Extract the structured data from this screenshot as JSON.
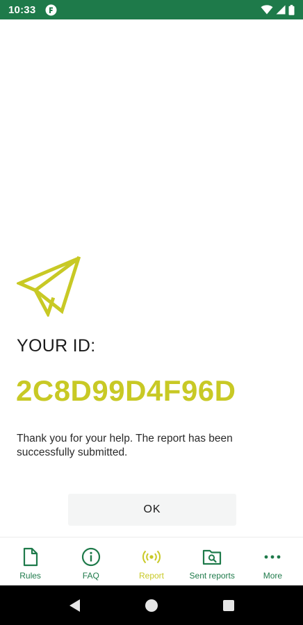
{
  "status_bar": {
    "time": "10:33",
    "bg_color": "#1e7a4a"
  },
  "confirmation": {
    "icon": "paper-plane-icon",
    "id_label": "YOUR ID:",
    "id_value": "2C8D99D4F96D",
    "message": "Thank you for your help. The report has been successfully submitted.",
    "ok_label": "OK",
    "accent_color": "#c8c925"
  },
  "bottom_nav": {
    "items": [
      {
        "label": "Rules",
        "icon": "document-icon",
        "active": false
      },
      {
        "label": "FAQ",
        "icon": "info-icon",
        "active": false
      },
      {
        "label": "Report",
        "icon": "broadcast-icon",
        "active": true
      },
      {
        "label": "Sent reports",
        "icon": "folder-search-icon",
        "active": false
      },
      {
        "label": "More",
        "icon": "more-dots-icon",
        "active": false
      }
    ],
    "color": "#1e7a4a",
    "active_color": "#c8c925"
  },
  "system_nav": {
    "icons": [
      "back-icon",
      "home-icon",
      "recents-icon"
    ]
  }
}
